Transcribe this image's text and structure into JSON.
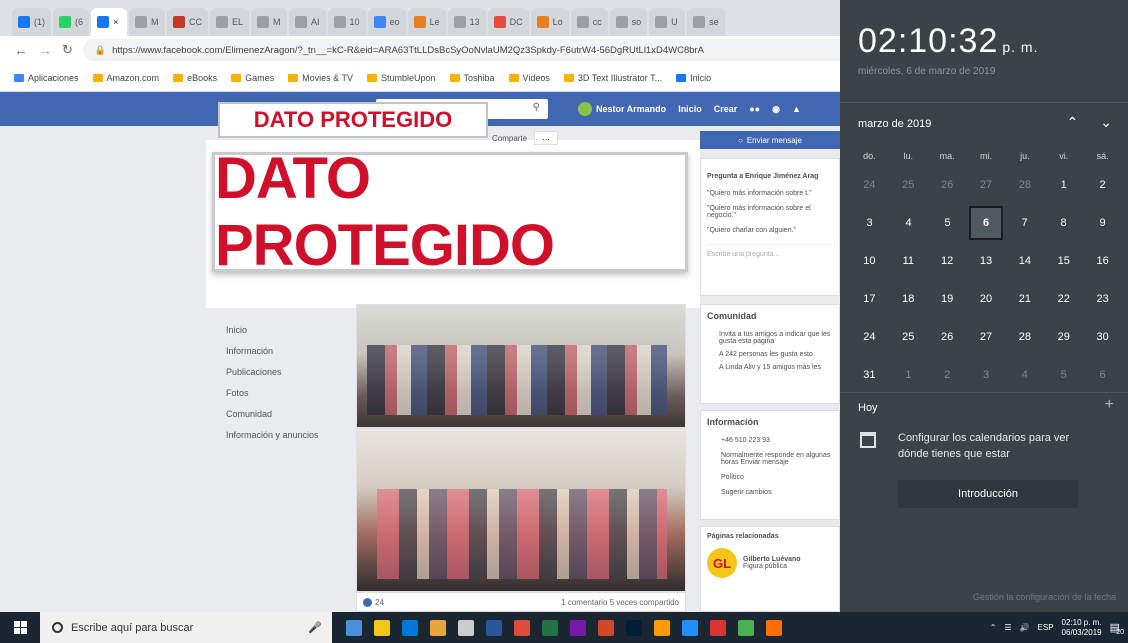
{
  "browser": {
    "tabs": [
      {
        "label": "(1)",
        "color": "#1877f2"
      },
      {
        "label": "(6",
        "color": "#25d366"
      },
      {
        "label": "×",
        "color": "#1877f2",
        "active": true
      },
      {
        "label": "M",
        "color": "#9aa0a6"
      },
      {
        "label": "CC",
        "color": "#c0392b"
      },
      {
        "label": "EL",
        "color": "#9aa0a6"
      },
      {
        "label": "M",
        "color": "#9aa0a6"
      },
      {
        "label": "AI",
        "color": "#9aa0a6"
      },
      {
        "label": "10",
        "color": "#9aa0a6"
      },
      {
        "label": "eo",
        "color": "#4285f4"
      },
      {
        "label": "Le",
        "color": "#e67e22"
      },
      {
        "label": "13",
        "color": "#9aa0a6"
      },
      {
        "label": "DC",
        "color": "#e74c3c"
      },
      {
        "label": "Lo",
        "color": "#e67e22"
      },
      {
        "label": "cc",
        "color": "#9aa0a6"
      },
      {
        "label": "so",
        "color": "#9aa0a6"
      },
      {
        "label": "U",
        "color": "#9aa0a6"
      },
      {
        "label": "se",
        "color": "#9aa0a6"
      }
    ],
    "url": "https://www.facebook.com/ElimenezAragon/?_tn__=kC-R&eid=ARA63TtLLDsBcSyOoNvlaUM2Qz3Spkdy-F6utrW4-56DgRUtLl1xD4WC8brA",
    "bookmarks": [
      "Aplicaciones",
      "Amazon.com",
      "eBooks",
      "Games",
      "Movies & TV",
      "StumbleUpon",
      "Toshiba",
      "Videos",
      "3D Text Illustrator T...",
      "Inicio"
    ]
  },
  "fb": {
    "user": "Nestor Armando",
    "nav": [
      "Inicio",
      "Crear"
    ],
    "protected_small": "DATO PROTEGIDO",
    "protected_big": "DATO PROTEGIDO",
    "send_message": "Enviar mensaje",
    "tab_fragment": "Comparte",
    "left_nav": [
      "Inicio",
      "Información",
      "Publicaciones",
      "Fotos",
      "Comunidad",
      "Información y anuncios"
    ],
    "ask_title": "Pregunta a Enrique Jiménez Arag",
    "ask_options": [
      "\"Quiero más información sobre t.\"",
      "\"Quiero más información sobre el negocio.\"",
      "\"Quiero charlar con alguien.\""
    ],
    "ask_placeholder": "Escribe una pregunta...",
    "community_title": "Comunidad",
    "community_items": [
      "Invita a tus amigos a indicar que les gusta esta página",
      "A 242 personas les gusta esto",
      "A Linda Aliv y 15 amigos más les"
    ],
    "info_title": "Información",
    "info_items": [
      "+46 510 223 93",
      "Normalmente responde en algunas horas Enviar mensaje",
      "Político",
      "Sugerir cambios"
    ],
    "related_title": "Páginas relacionadas",
    "related_name": "Gilberto Luévano",
    "related_role": "Figura pública",
    "related_initials": "GL",
    "reactions": "24",
    "comments": "1 comentario  5 veces compartido"
  },
  "calendar": {
    "time": "02:10:32",
    "ampm": "p. m.",
    "date": "miércoles, 6 de marzo de 2019",
    "month": "marzo de 2019",
    "weekdays": [
      "do.",
      "lu.",
      "ma.",
      "mi.",
      "ju.",
      "vi.",
      "sá."
    ],
    "weeks": [
      [
        {
          "d": "24",
          "dim": true
        },
        {
          "d": "25",
          "dim": true
        },
        {
          "d": "26",
          "dim": true
        },
        {
          "d": "27",
          "dim": true
        },
        {
          "d": "28",
          "dim": true
        },
        {
          "d": "1"
        },
        {
          "d": "2"
        }
      ],
      [
        {
          "d": "3"
        },
        {
          "d": "4"
        },
        {
          "d": "5"
        },
        {
          "d": "6",
          "today": true
        },
        {
          "d": "7"
        },
        {
          "d": "8"
        },
        {
          "d": "9"
        }
      ],
      [
        {
          "d": "10"
        },
        {
          "d": "11"
        },
        {
          "d": "12"
        },
        {
          "d": "13"
        },
        {
          "d": "14"
        },
        {
          "d": "15"
        },
        {
          "d": "16"
        }
      ],
      [
        {
          "d": "17"
        },
        {
          "d": "18"
        },
        {
          "d": "19"
        },
        {
          "d": "20"
        },
        {
          "d": "21"
        },
        {
          "d": "22"
        },
        {
          "d": "23"
        }
      ],
      [
        {
          "d": "24"
        },
        {
          "d": "25"
        },
        {
          "d": "26"
        },
        {
          "d": "27"
        },
        {
          "d": "28"
        },
        {
          "d": "29"
        },
        {
          "d": "30"
        }
      ],
      [
        {
          "d": "31"
        },
        {
          "d": "1",
          "dim": true
        },
        {
          "d": "2",
          "dim": true
        },
        {
          "d": "3",
          "dim": true
        },
        {
          "d": "4",
          "dim": true
        },
        {
          "d": "5",
          "dim": true
        },
        {
          "d": "6",
          "dim": true
        }
      ]
    ],
    "today_label": "Hoy",
    "add": "+",
    "configure_text": "Configurar los calendarios para ver dónde tienes que estar",
    "intro_button": "Introducción",
    "footer": "Gestión la configuración de la fecha"
  },
  "taskbar": {
    "search_placeholder": "Escribe aquí para buscar",
    "apps": [
      "#4a90d9",
      "#f5c518",
      "#0078d7",
      "#e8a33d",
      "#cccccc",
      "#2b579a",
      "#dd4b39",
      "#217346",
      "#7719aa",
      "#d24726",
      "#001e36",
      "#ff9a00",
      "#1e90ff",
      "#d33",
      "#4caf50",
      "#ff6f00"
    ],
    "lang": "ESP",
    "time": "02:10 p. m.",
    "date": "06/03/2019",
    "notif": "20"
  },
  "icons": [
    "facebook-icon",
    "search-icon",
    "calendar-icon",
    "windows-icon",
    "microphone-icon",
    "chevron-up-icon",
    "chevron-down-icon"
  ]
}
